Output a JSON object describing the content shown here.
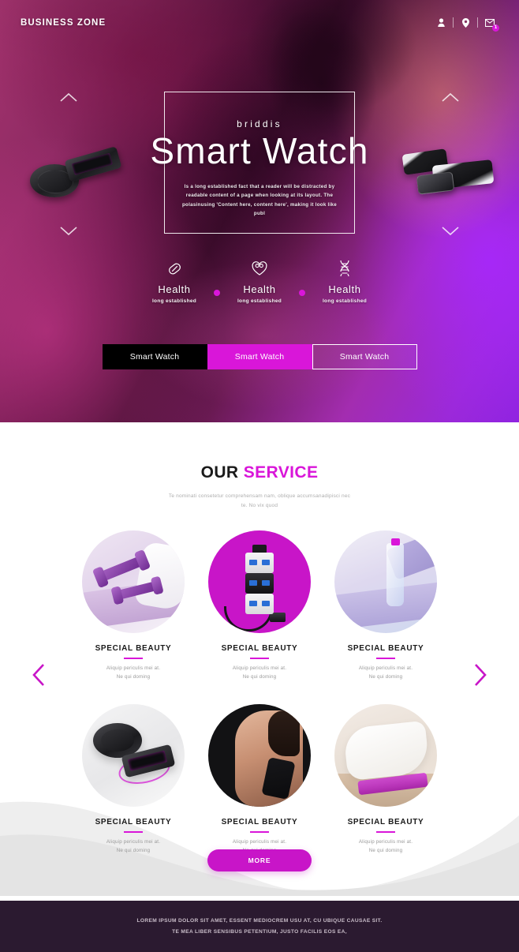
{
  "header": {
    "brand": "BUSINESS ZONE",
    "icons": [
      {
        "name": "user-icon",
        "label": "user"
      },
      {
        "name": "location-pin-icon",
        "label": "location"
      },
      {
        "name": "mail-icon",
        "label": "messages",
        "badge": "1"
      }
    ]
  },
  "hero": {
    "eyebrow": "briddis",
    "title": "Smart Watch",
    "description": "Is a long established fact that a reader will be distracted by readable content of a page when looking at its layout. The polasinusing 'Content here, content here', making it look like publ",
    "nav": {
      "up": "chevron-up",
      "down": "chevron-down"
    },
    "features": [
      {
        "icon": "pill-capsule-icon",
        "title": "Health",
        "subtitle": "long established"
      },
      {
        "icon": "heartbeat-icon",
        "title": "Health",
        "subtitle": "long established"
      },
      {
        "icon": "dna-helix-icon",
        "title": "Health",
        "subtitle": "long established"
      }
    ],
    "buttons": [
      {
        "label": "Smart Watch",
        "style": "dark"
      },
      {
        "label": "Smart Watch",
        "style": "pink"
      },
      {
        "label": "Smart Watch",
        "style": "ghost"
      }
    ]
  },
  "service": {
    "title_main": "OUR ",
    "title_accent": "SERVICE",
    "subtitle": "Te nominati consetetur comprehensam nam, oblique accumsanadipisci nec te. No vix quod",
    "cards": [
      {
        "title": "SPECIAL BEAUTY",
        "desc": "Aliquip periculis mei at.\nNe qui doming",
        "image": "purple-dumbbells-on-yoga-mat"
      },
      {
        "title": "SPECIAL BEAUTY",
        "desc": "Aliquip periculis mei at.\nNe qui doming",
        "image": "usb-hub-with-cable"
      },
      {
        "title": "SPECIAL BEAUTY",
        "desc": "Aliquip periculis mei at.\nNe qui doming",
        "image": "water-bottle-on-yoga-mat"
      },
      {
        "title": "SPECIAL BEAUTY",
        "desc": "Aliquip periculis mei at.\nNe qui doming",
        "image": "wireless-charging-pad-and-phone"
      },
      {
        "title": "SPECIAL BEAUTY",
        "desc": "Aliquip periculis mei at.\nNe qui doming",
        "image": "woman-stretching-shoulder"
      },
      {
        "title": "SPECIAL BEAUTY",
        "desc": "Aliquip periculis mei at.\nNe qui doming",
        "image": "white-towel-on-mat"
      }
    ],
    "prev_arrow": "chevron-left",
    "next_arrow": "chevron-right",
    "more_label": "MORE"
  },
  "footer": {
    "line1": "LOREM IPSUM DOLOR SIT AMET, ESSENT MEDIOCREM USU AT, CU UBIQUE CAUSAE SIT.",
    "line2": "TE MEA LIBER SENSIBUS PETENTIUM, JUSTO FACILIS EOS EA,"
  },
  "colors": {
    "accent": "#d916d9",
    "accent_dark": "#c815c8",
    "footer_bg": "#2b1a30",
    "hero_dark": "#3d0c2c",
    "hero_violet": "#8f23e0"
  }
}
